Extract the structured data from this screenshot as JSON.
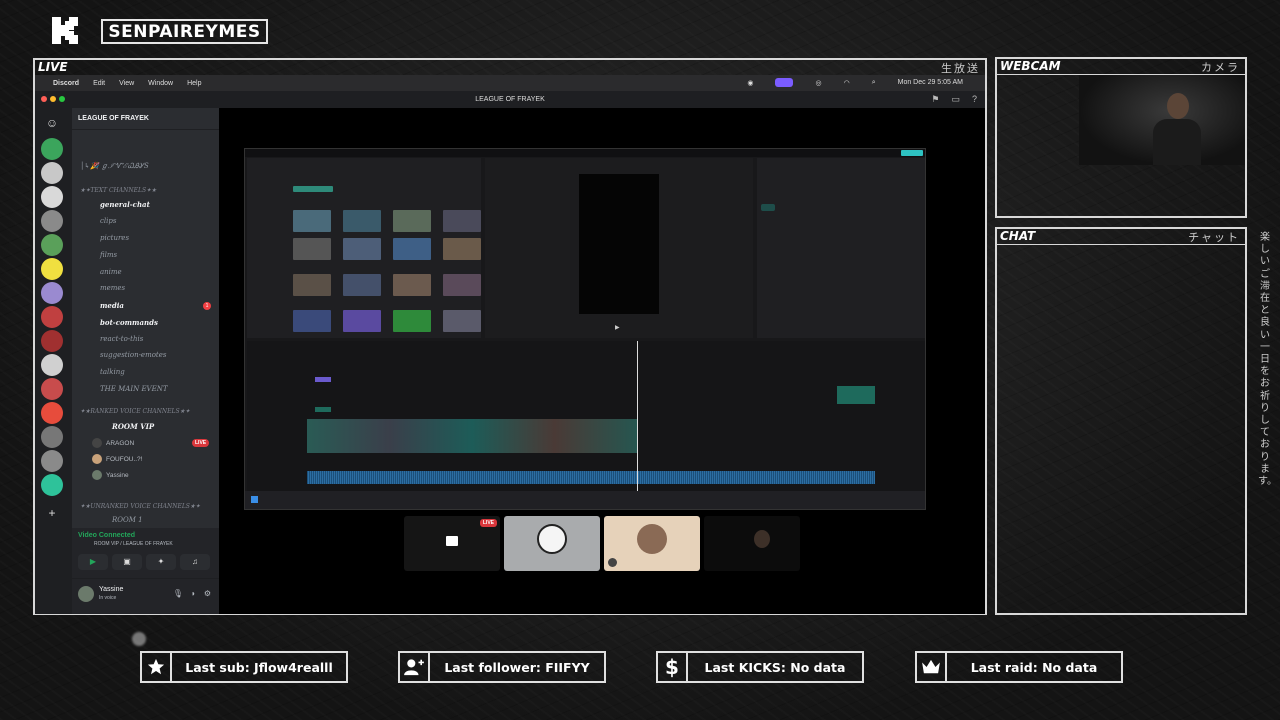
{
  "overlay": {
    "channel_name": "SENPAIREYMES",
    "live_label": "LIVE",
    "live_jp": "生放送",
    "webcam_label": "WEBCAM",
    "webcam_jp": "カメラ",
    "chat_label": "CHAT",
    "chat_jp": "チャット",
    "vertical_jp": "楽しいご滞在と良い一日をお祈りしております。"
  },
  "mac_menubar": {
    "items": [
      "Discord",
      "Edit",
      "View",
      "Window",
      "Help"
    ],
    "clock": "Mon Dec 29  5:05 AM"
  },
  "discord": {
    "window_title": "LEAGUE OF FRAYEK",
    "guild_name": "LEAGUE OF FRAYEK",
    "channels": [
      {
        "name": "giveaways",
        "label": "│↳🎉 ℊℐᏉℰᏇᎯᎽЅ"
      },
      {
        "name": "text-category",
        "label": "★✦TEXT CHANNELS✦★"
      },
      {
        "name": "general-chat",
        "label": "general-chat"
      },
      {
        "name": "clips",
        "label": "clips"
      },
      {
        "name": "pictures",
        "label": "pictures"
      },
      {
        "name": "films",
        "label": "films"
      },
      {
        "name": "anime",
        "label": "anime"
      },
      {
        "name": "memes",
        "label": "memes"
      },
      {
        "name": "media",
        "label": "media"
      },
      {
        "name": "bot-commands",
        "label": "bot-commands"
      },
      {
        "name": "react-to-this",
        "label": "react-to-this"
      },
      {
        "name": "suggestion-emotes",
        "label": "suggestion-emotes"
      },
      {
        "name": "talking",
        "label": "talking"
      },
      {
        "name": "main-event",
        "label": "THE MAIN EVENT"
      },
      {
        "name": "ranked-category",
        "label": "✦★RANKED VOICE CHANNELS★✦"
      },
      {
        "name": "room-vip",
        "label": "ROOM VIP"
      },
      {
        "name": "unranked-category",
        "label": "✦★UNRANKED VOICE CHANNELS★✦"
      },
      {
        "name": "room-1",
        "label": "ROOM 1"
      }
    ],
    "media_mentions": "1",
    "voice_users": [
      {
        "name": "ARAGON",
        "live": "LIVE"
      },
      {
        "name": "FOUFOU..?!"
      },
      {
        "name": "Yassine"
      }
    ],
    "voice_status": "Video Connected",
    "voice_location": "ROOM VIP / LEAGUE OF FRAYEK",
    "user_name": "Yassine",
    "user_status": "In voice"
  },
  "call_tiles": {
    "live_badge": "LIVE"
  },
  "stats": {
    "last_sub": "Last sub: Jflow4realll",
    "last_follower": "Last follower: FIIFYY",
    "last_kicks": "Last KICKS: No data",
    "last_raid": "Last raid: No data"
  },
  "colors": {
    "frame": "#d8d8d8",
    "discord_bg": "#2b2d31",
    "voice_green": "#23a55a",
    "live_red": "#da373c"
  }
}
